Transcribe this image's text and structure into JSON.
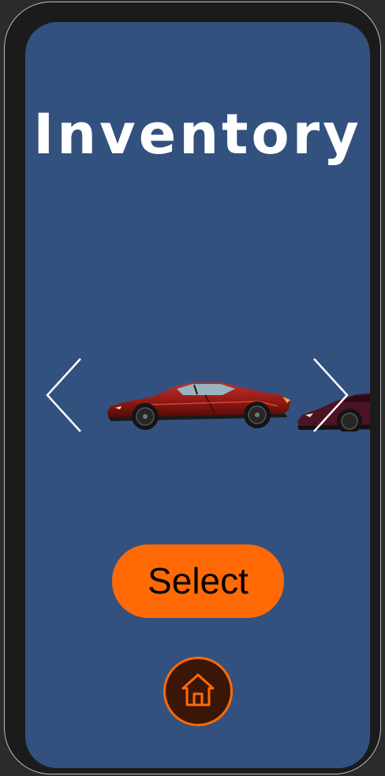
{
  "screen": {
    "title": "Inventory",
    "background_color": "#33517e"
  },
  "carousel": {
    "prev_icon": "chevron-left-icon",
    "next_icon": "chevron-right-icon",
    "items": [
      {
        "color": "#a8211c",
        "icon": "red-sports-car"
      },
      {
        "color": "#5a1a2e",
        "icon": "maroon-sports-car"
      }
    ]
  },
  "actions": {
    "select_label": "Select",
    "select_color": "#ff6a06",
    "home_icon": "home-icon"
  }
}
